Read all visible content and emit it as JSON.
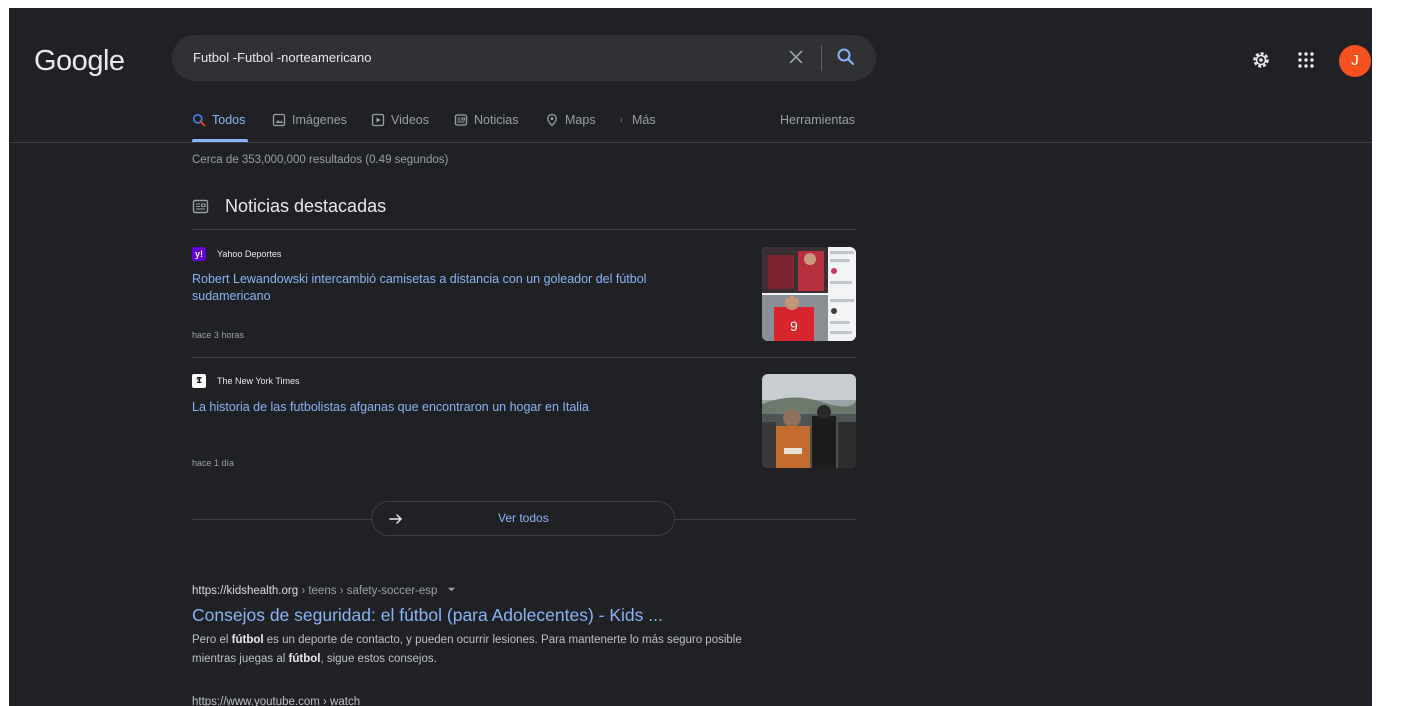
{
  "header": {
    "logo_text": "Google",
    "query": "Futbol -Futbol -norteamericano",
    "avatar_letter": "J",
    "avatar_color": "#f4511e"
  },
  "tabs": [
    {
      "label": "Todos",
      "icon": "search-icon",
      "active": true
    },
    {
      "label": "Imágenes",
      "icon": "image-icon"
    },
    {
      "label": "Videos",
      "icon": "play-icon"
    },
    {
      "label": "Noticias",
      "icon": "news-icon"
    },
    {
      "label": "Maps",
      "icon": "map-pin-icon"
    },
    {
      "label": "Más",
      "icon": "more-vert-icon"
    }
  ],
  "tools_label": "Herramientas",
  "stats": "Cerca de 353,000,000 resultados (0.49 segundos)",
  "top_stories": {
    "title": "Noticias destacadas",
    "items": [
      {
        "source": "Yahoo Deportes",
        "source_icon_text": "y!",
        "headline": "Robert Lewandowski intercambió camisetas a distancia con un goleador del fútbol sudamericano",
        "time": "hace 3 horas"
      },
      {
        "source": "The New York Times",
        "source_icon_text": "𝕿",
        "headline": "La historia de las futbolistas afganas que encontraron un hogar en Italia",
        "time": "hace 1 día"
      }
    ],
    "see_all": "Ver todos"
  },
  "results": [
    {
      "host": "https://kidshealth.org",
      "path": " › teens › safety-soccer-esp",
      "title": "Consejos de seguridad: el fútbol (para Adolecentes) - Kids ...",
      "snippet_parts": [
        "Pero el ",
        "fútbol",
        " es un deporte de contacto, y pueden ocurrir lesiones. Para mantenerte lo más seguro posible mientras juegas al ",
        "fútbol",
        ", sigue estos consejos."
      ]
    }
  ],
  "next_result_host": "https://www.youtube.com › watch",
  "colors": {
    "background": "#202124",
    "link": "#8ab4f8",
    "text": "#bdc1c6"
  }
}
